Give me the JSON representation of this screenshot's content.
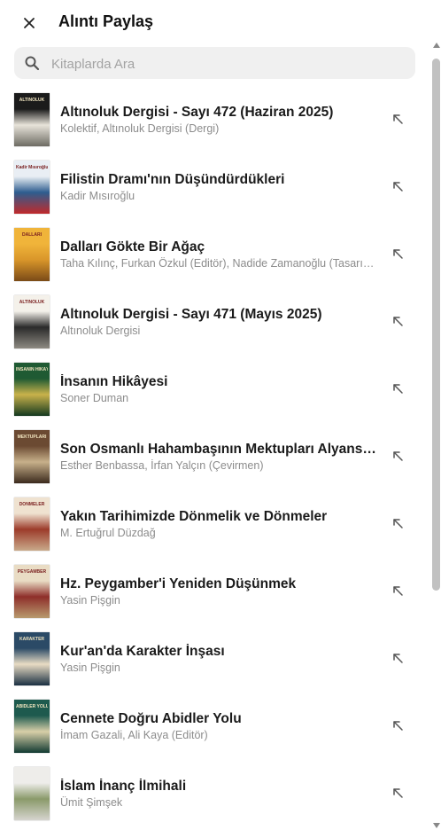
{
  "header": {
    "title": "Alıntı Paylaş",
    "close_icon": "close-icon"
  },
  "search": {
    "placeholder": "Kitaplarda Ara",
    "value": ""
  },
  "books": [
    {
      "title": "Altınoluk Dergisi - Sayı 472 (Haziran 2025)",
      "author": "Kolektif, Altınoluk Dergisi (Dergi)",
      "cover_colors": [
        "#1b1b1b",
        "#e8e4da",
        "#6d6b63"
      ],
      "cover_text": "ALTINOLUK"
    },
    {
      "title": "Filistin Dramı'nın Düşündürdükleri",
      "author": "Kadir Mısıroğlu",
      "cover_colors": [
        "#e9eef4",
        "#2d5d8f",
        "#c0292b"
      ],
      "cover_text": "Kadir Mısıroğlu"
    },
    {
      "title": "Dalları Gökte Bir Ağaç",
      "author": "Taha Kılınç, Furkan Özkul (Editör), Nadide Zamanoğlu (Tasarım)",
      "cover_colors": [
        "#f0b43a",
        "#d9962a",
        "#7a4a17"
      ],
      "cover_text": "DALLARI"
    },
    {
      "title": "Altınoluk Dergisi - Sayı 471 (Mayıs 2025)",
      "author": "Altınoluk Dergisi",
      "cover_colors": [
        "#f4f1ea",
        "#2a2a2a",
        "#8d8a82"
      ],
      "cover_text": "ALTINOLUK"
    },
    {
      "title": "İnsanın Hikâyesi",
      "author": "Soner Duman",
      "cover_colors": [
        "#1f5a33",
        "#c9b24b",
        "#14391f"
      ],
      "cover_text": "İNSANIN HİKÂYESİ"
    },
    {
      "title": "Son Osmanlı Hahambaşının Mektupları Alyans’taki Yahudiler",
      "author": "Esther Benbassa, İrfan Yalçın (Çevirmen)",
      "cover_colors": [
        "#6b4a32",
        "#c7b08a",
        "#3b2a1d"
      ],
      "cover_text": "MEKTUPLARI"
    },
    {
      "title": "Yakın Tarihimizde Dönmelik ve Dönmeler",
      "author": "M. Ertuğrul Düzdağ",
      "cover_colors": [
        "#efe2d0",
        "#9c3b2a",
        "#c9a98a"
      ],
      "cover_text": "DÖNMELER"
    },
    {
      "title": "Hz. Peygamber'i Yeniden Düşünmek",
      "author": "Yasin Pişgin",
      "cover_colors": [
        "#e9dcc4",
        "#8e2e2a",
        "#b89a6e"
      ],
      "cover_text": "PEYGAMBER"
    },
    {
      "title": "Kur'an'da Karakter İnşası",
      "author": "Yasin Pişgin",
      "cover_colors": [
        "#2b4a66",
        "#e9dcc4",
        "#1a2f42"
      ],
      "cover_text": "KARAKTER"
    },
    {
      "title": "Cennete Doğru Abidler Yolu",
      "author": "İmam Gazali, Ali Kaya (Editör)",
      "cover_colors": [
        "#1e5a4e",
        "#d8cfa8",
        "#123a32"
      ],
      "cover_text": "ABİDLER YOLU"
    },
    {
      "title": "İslam İnanç İlmihali",
      "author": "Ümit Şimşek",
      "cover_colors": [
        "#eeedea",
        "#8a9a6a",
        "#d6d4ce"
      ],
      "cover_text": ""
    }
  ],
  "icons": {
    "search": "search-icon",
    "share": "share-arrow-icon"
  }
}
